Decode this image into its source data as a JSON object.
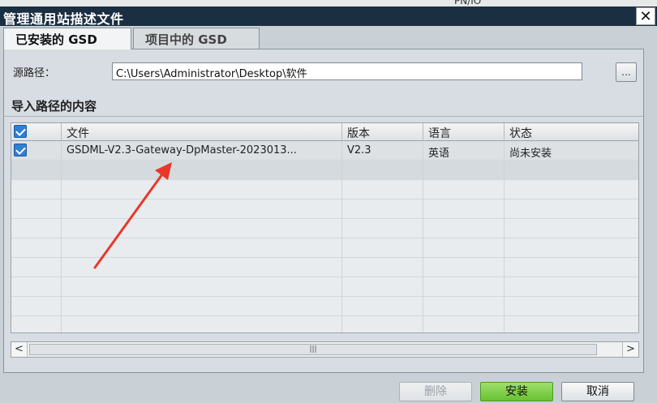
{
  "background": {
    "partial_text": "PN/IO"
  },
  "dialog": {
    "title": "管理通用站描述文件",
    "close_glyph": "✕"
  },
  "tabs": [
    {
      "label": "已安装的 GSD",
      "active": true
    },
    {
      "label": "项目中的 GSD",
      "active": false
    }
  ],
  "source_path": {
    "label": "源路径：",
    "value": "C:\\Users\\Administrator\\Desktop\\软件",
    "browse_label": "..."
  },
  "section": {
    "title": "导入路径的内容"
  },
  "table": {
    "header_checked": true,
    "columns": [
      "文件",
      "版本",
      "语言",
      "状态"
    ],
    "rows": [
      {
        "checked": true,
        "file": "GSDML-V2.3-Gateway-DpMaster-2023013...",
        "version": "V2.3",
        "language": "英语",
        "status": "尚未安装"
      }
    ]
  },
  "scrollbar": {
    "left_glyph": "<",
    "right_glyph": ">",
    "thumb_glyph": "|||"
  },
  "buttons": {
    "delete": "删除",
    "install": "安装",
    "cancel": "取消"
  },
  "colors": {
    "title_bar": "#1b2f42",
    "checkbox": "#2f7fd4",
    "install_button": "#67c232",
    "annotation_arrow": "#e8382a"
  },
  "icons": [
    "close-icon",
    "checkbox-checked-icon",
    "scroll-left-icon",
    "scroll-right-icon",
    "annotation-arrow-icon"
  ]
}
